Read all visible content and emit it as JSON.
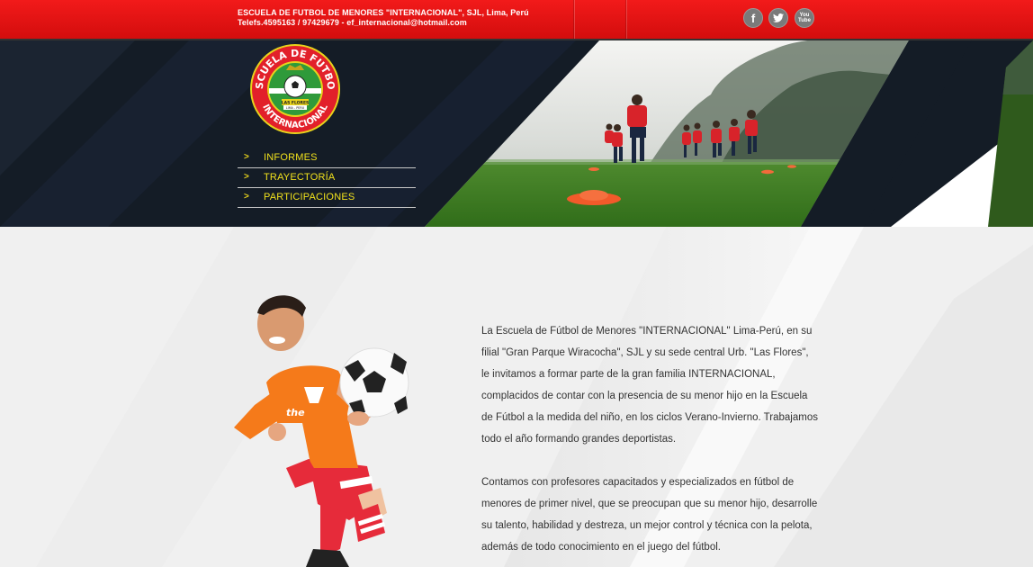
{
  "header": {
    "line1": "ESCUELA DE FUTBOL DE MENORES \"INTERNACIONAL\", SJL, Lima, Perú",
    "line2": "Telefs.4595163 / 97429679 - ef_internacional@hotmail.com",
    "social": [
      {
        "icon": "facebook-icon",
        "glyph": "f"
      },
      {
        "icon": "twitter-icon",
        "glyph": ""
      },
      {
        "icon": "youtube-icon",
        "glyph": "You\nTube"
      }
    ]
  },
  "logo": {
    "top_text": "ESCUELA DE FUTBOL",
    "bottom_text": "INTERNACIONAL",
    "ribbon": "LAS FLORES",
    "subribbon": "LIMA - PERU"
  },
  "menu": [
    {
      "arrow": ">",
      "label": "INFORMES"
    },
    {
      "arrow": ">",
      "label": "TRAYECTORÍA"
    },
    {
      "arrow": ">",
      "label": "PARTICIPACIONES"
    }
  ],
  "content": {
    "kid_shirt_text": "the",
    "paragraphs": [
      "La Escuela de Fútbol de Menores \"INTERNACIONAL\" Lima-Perú, en su filial \"Gran Parque Wiracocha\", SJL y su sede central Urb. \"Las Flores\", le invitamos a formar parte de la gran familia INTERNACIONAL, complacidos de contar con la presencia de su menor hijo en la Escuela de Fútbol a la medida del niño, en los ciclos Verano-Invierno. Trabajamos todo el año formando grandes deportistas.",
      "Contamos con profesores capacitados y especializados en fútbol de menores de primer nivel, que se preocupan que su menor hijo, desarrolle su talento, habilidad y destreza, un mejor control y técnica con la pelota, además de todo conocimiento en el juego del fútbol."
    ]
  },
  "colors": {
    "topbar_red": "#e01414",
    "hero_dark": "#141c26",
    "menu_yellow": "#f2e21c",
    "body_text": "#333333"
  }
}
